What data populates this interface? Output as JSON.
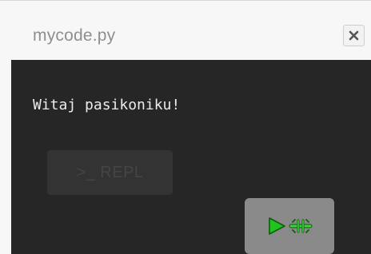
{
  "window": {
    "title": "mycode.py",
    "close_icon": "close-icon"
  },
  "console": {
    "output_text": "Witaj pasikoniku!"
  },
  "buttons": {
    "repl_label": ">_ REPL",
    "run_icons": [
      "play-icon",
      "grasshopper-icon"
    ]
  },
  "colors": {
    "console_bg": "#262626",
    "run_button_bg": "#8a8a8a",
    "play_green": "#22c21f"
  }
}
